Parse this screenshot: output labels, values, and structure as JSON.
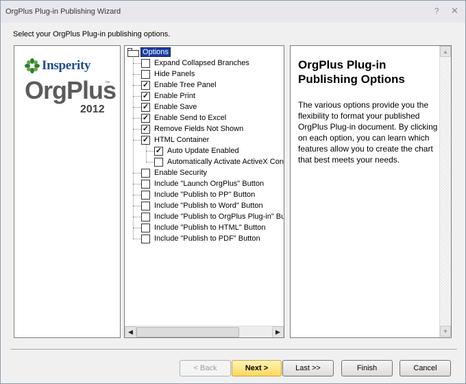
{
  "window": {
    "title": "OrgPlus Plug-in Publishing Wizard",
    "help_glyph": "?",
    "close_glyph": "✕"
  },
  "instruction": "Select your OrgPlus Plug-in publishing options.",
  "logo": {
    "company": "Insperity",
    "product": "OrgPlus",
    "trademark": "™",
    "year": "2012"
  },
  "tree": {
    "root_label": "Options",
    "items": [
      {
        "label": "Expand Collapsed Branches",
        "checked": false
      },
      {
        "label": "Hide Panels",
        "checked": false
      },
      {
        "label": "Enable Tree Panel",
        "checked": true
      },
      {
        "label": "Enable Print",
        "checked": true
      },
      {
        "label": "Enable Save",
        "checked": true
      },
      {
        "label": "Enable Send to Excel",
        "checked": true
      },
      {
        "label": "Remove Fields Not Shown",
        "checked": true
      },
      {
        "label": "HTML Container",
        "checked": true
      },
      {
        "label": "Auto Update Enabled",
        "checked": true
      },
      {
        "label": "Automatically Activate ActiveX Controls",
        "checked": false
      },
      {
        "label": "Enable Security",
        "checked": false
      },
      {
        "label": "Include \"Launch OrgPlus\" Button",
        "checked": false
      },
      {
        "label": "Include \"Publish to PP\" Button",
        "checked": false
      },
      {
        "label": "Include \"Publish to Word\" Button",
        "checked": false
      },
      {
        "label": "Include \"Publish to OrgPlus Plug-in\" Button",
        "checked": false
      },
      {
        "label": "Include \"Publish to HTML\" Button",
        "checked": false
      },
      {
        "label": "Include \"Publish to PDF\" Button",
        "checked": false
      }
    ],
    "scroll_left_glyph": "◀",
    "scroll_right_glyph": "▶"
  },
  "description": {
    "title": "OrgPlus Plug-in Publishing Options",
    "body": "The various options provide you the flexibility to format your published OrgPlus Plug-in document. By clicking on each option, you can learn which features allow you to create the chart that best meets your needs.",
    "scroll_up_glyph": "▲",
    "scroll_down_glyph": "▼"
  },
  "buttons": {
    "back": "< Back",
    "next": "Next >",
    "last": "Last >>",
    "finish": "Finish",
    "cancel": "Cancel"
  }
}
